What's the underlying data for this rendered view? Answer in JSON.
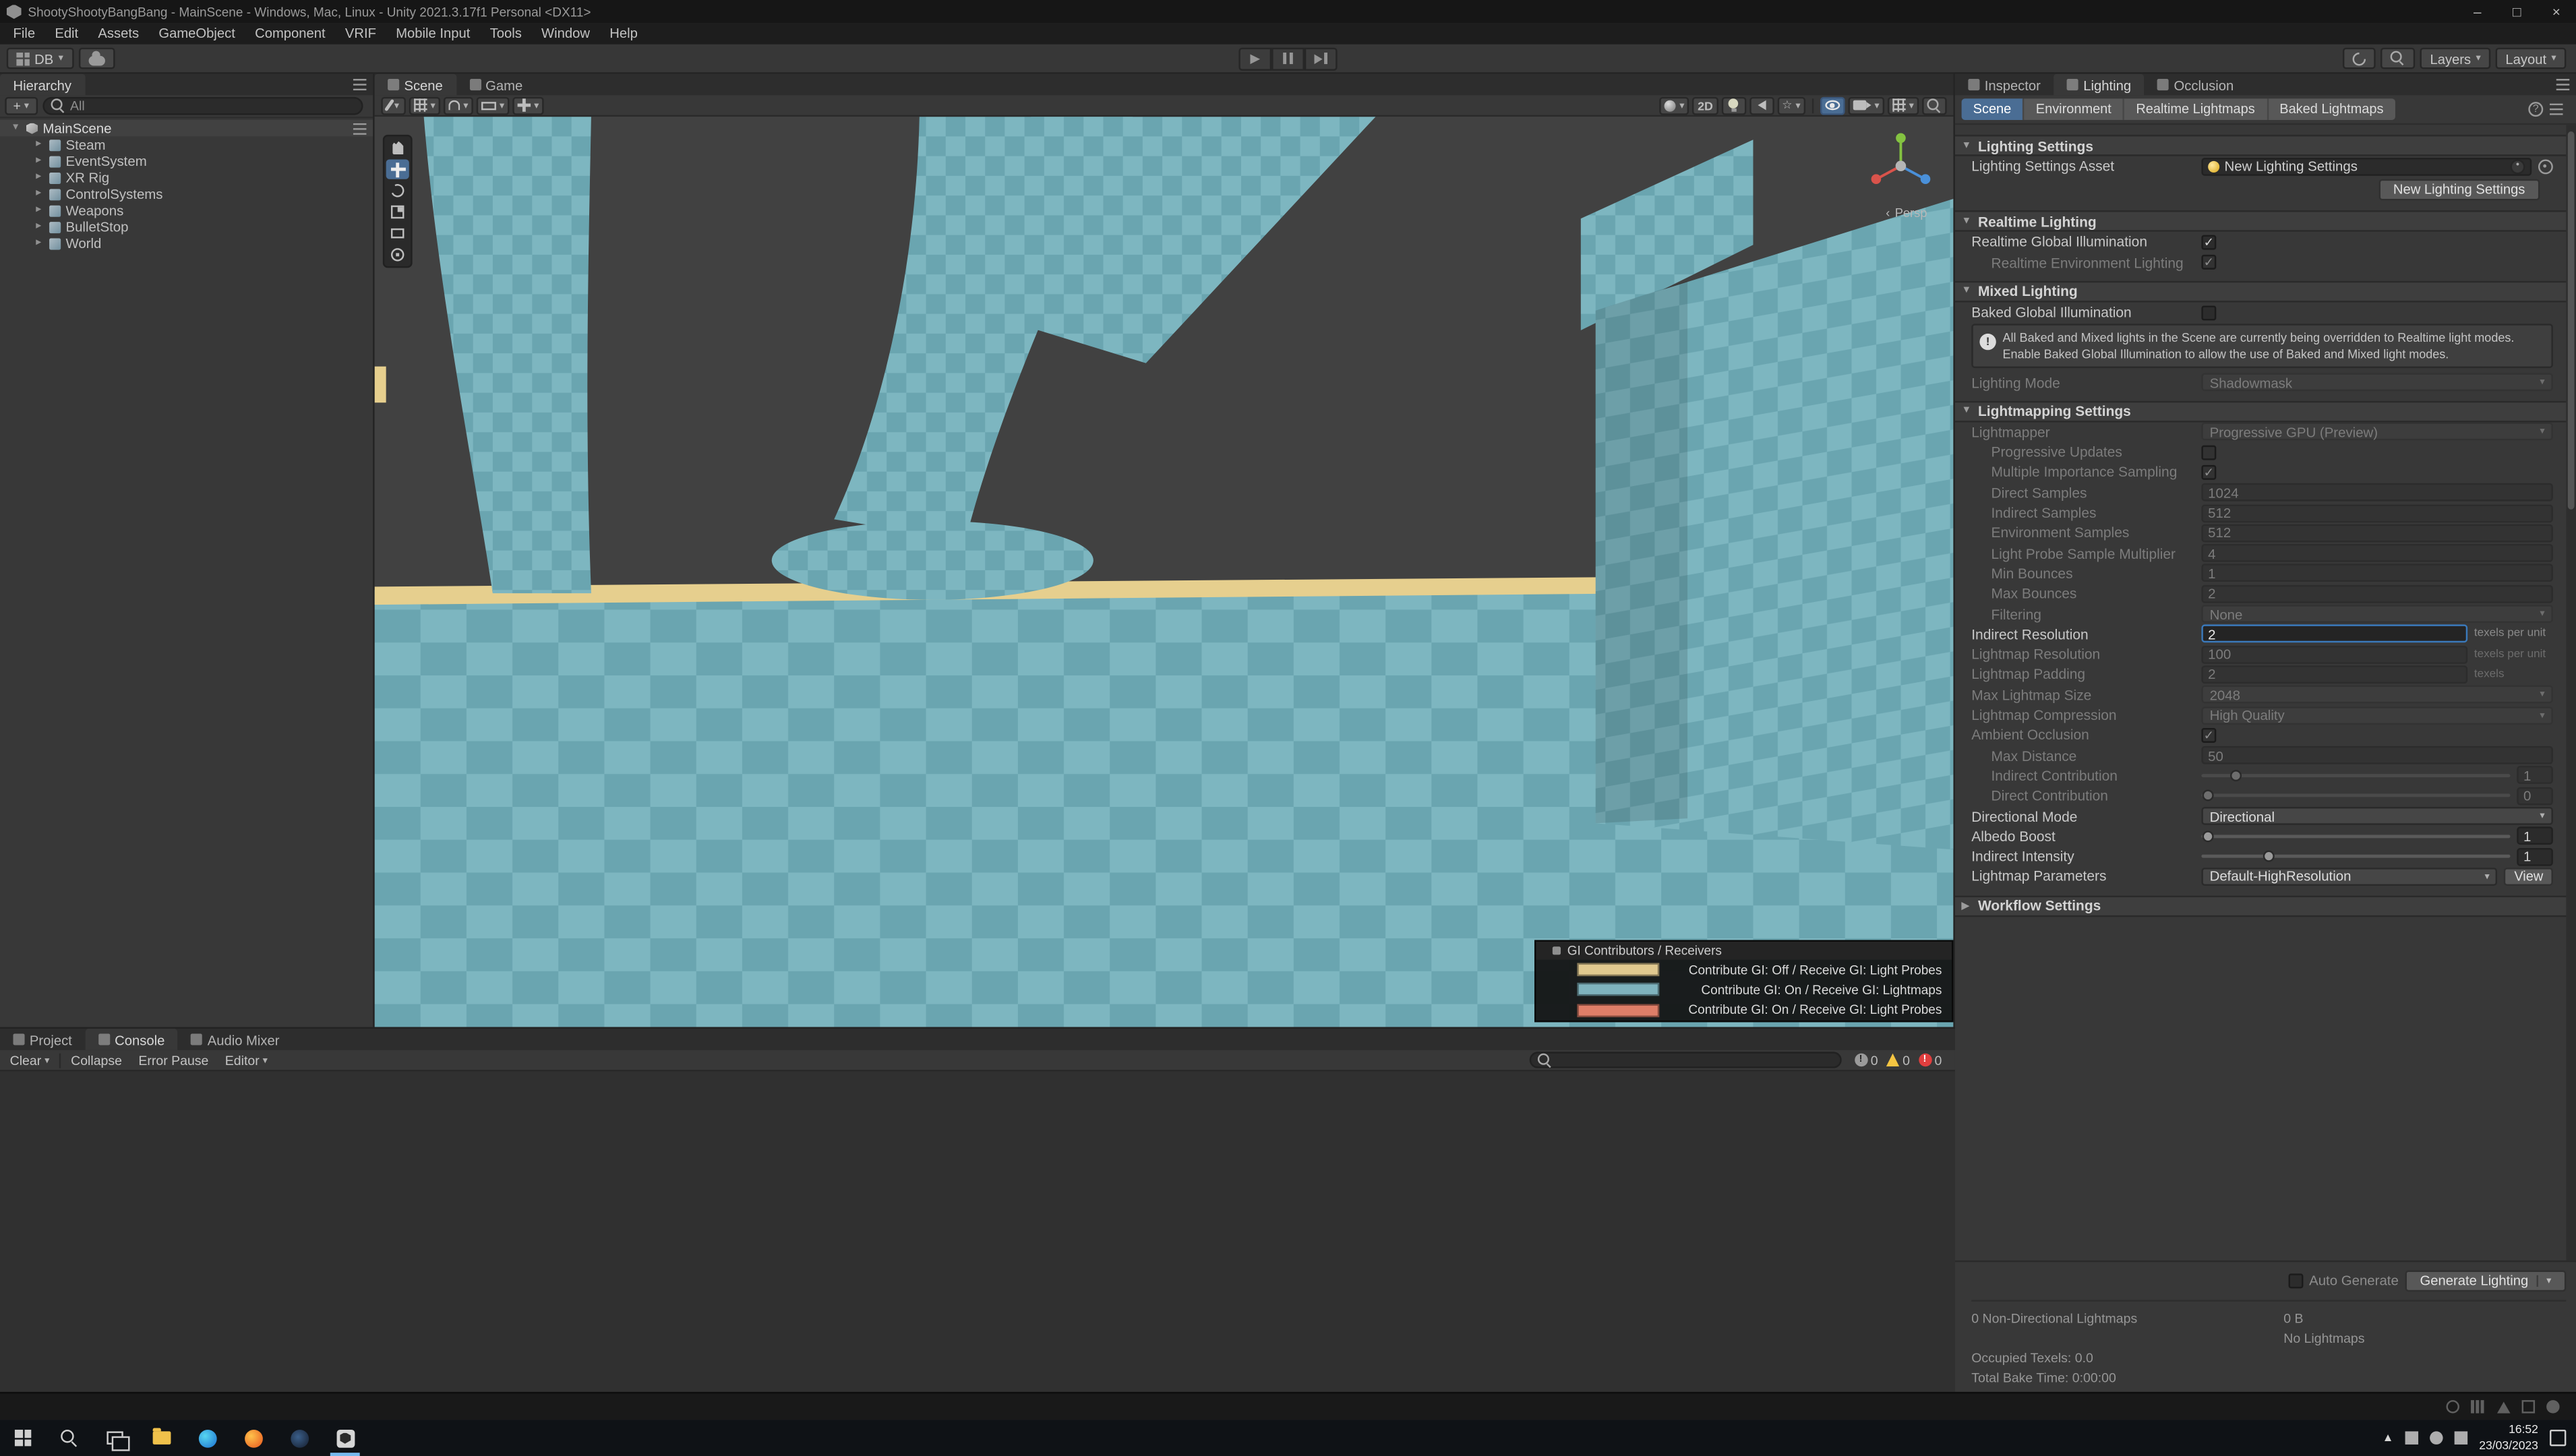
{
  "window": {
    "title": "ShootyShootyBangBang - MainScene - Windows, Mac, Linux - Unity 2021.3.17f1 Personal <DX11>",
    "menu_items": [
      "File",
      "Edit",
      "Assets",
      "GameObject",
      "Component",
      "VRIF",
      "Mobile Input",
      "Tools",
      "Window",
      "Help"
    ]
  },
  "toolbar": {
    "version_control": "DB",
    "layers": "Layers",
    "layout": "Layout"
  },
  "hierarchy": {
    "tab_title": "Hierarchy",
    "search_filter": "All",
    "scene_name": "MainScene",
    "items": [
      "Steam",
      "EventSystem",
      "XR Rig",
      "ControlSystems",
      "Weapons",
      "BulletStop",
      "World"
    ]
  },
  "scene_view": {
    "tabs": [
      "Scene",
      "Game"
    ],
    "active_tab": "Scene",
    "projection_label": "Persp",
    "gi_legend": {
      "title": "GI Contributors / Receivers",
      "rows": [
        {
          "color": "#e0c98f",
          "label": "Contribute GI: Off / Receive GI: Light Probes"
        },
        {
          "color": "#7fb3be",
          "label": "Contribute GI: On / Receive GI: Lightmaps"
        },
        {
          "color": "#de7e68",
          "label": "Contribute GI: On / Receive GI: Light Probes"
        }
      ]
    }
  },
  "inspector": {
    "tabs": [
      "Inspector",
      "Lighting",
      "Occlusion"
    ],
    "active_tab": "Lighting",
    "subtabs": [
      "Scene",
      "Environment",
      "Realtime Lightmaps",
      "Baked Lightmaps"
    ],
    "active_subtab": "Scene",
    "sections": [
      {
        "title": "Lighting Settings",
        "expanded": true,
        "rows": [
          {
            "type": "object",
            "label": "Lighting Settings Asset",
            "value": "New Lighting Settings"
          },
          {
            "type": "button_row",
            "button": "New Lighting Settings"
          }
        ]
      },
      {
        "title": "Realtime Lighting",
        "expanded": true,
        "rows": [
          {
            "type": "checkbox",
            "label": "Realtime Global Illumination",
            "checked": true
          },
          {
            "type": "checkbox",
            "label": "Realtime Environment Lighting",
            "checked": true,
            "disabled": true,
            "indent": 1
          }
        ]
      },
      {
        "title": "Mixed Lighting",
        "expanded": true,
        "rows": [
          {
            "type": "checkbox",
            "label": "Baked Global Illumination",
            "checked": false
          },
          {
            "type": "helpbox",
            "text": "All Baked and Mixed lights in the Scene are currently being overridden to Realtime light modes. Enable Baked Global Illumination to allow the use of Baked and Mixed light modes."
          },
          {
            "type": "dropdown",
            "label": "Lighting Mode",
            "value": "Shadowmask",
            "disabled": true
          }
        ]
      },
      {
        "title": "Lightmapping Settings",
        "expanded": true,
        "rows": [
          {
            "type": "dropdown",
            "label": "Lightmapper",
            "value": "Progressive GPU (Preview)",
            "disabled": true
          },
          {
            "type": "checkbox",
            "label": "Progressive Updates",
            "checked": false,
            "disabled": true,
            "indent": 1
          },
          {
            "type": "checkbox",
            "label": "Multiple Importance Sampling",
            "checked": true,
            "disabled": true,
            "indent": 1
          },
          {
            "type": "field",
            "label": "Direct Samples",
            "value": "1024",
            "disabled": true,
            "indent": 1
          },
          {
            "type": "field",
            "label": "Indirect Samples",
            "value": "512",
            "disabled": true,
            "indent": 1
          },
          {
            "type": "field",
            "label": "Environment Samples",
            "value": "512",
            "disabled": true,
            "indent": 1
          },
          {
            "type": "field",
            "label": "Light Probe Sample Multiplier",
            "value": "4",
            "disabled": true,
            "indent": 1
          },
          {
            "type": "field",
            "label": "Min Bounces",
            "value": "1",
            "disabled": true,
            "indent": 1
          },
          {
            "type": "field",
            "label": "Max Bounces",
            "value": "2",
            "disabled": true,
            "indent": 1
          },
          {
            "type": "dropdown",
            "label": "Filtering",
            "value": "None",
            "disabled": true,
            "indent": 1
          },
          {
            "type": "field",
            "label": "Indirect Resolution",
            "value": "2",
            "unit": "texels per unit",
            "active": true
          },
          {
            "type": "field",
            "label": "Lightmap Resolution",
            "value": "100",
            "unit": "texels per unit",
            "disabled": true
          },
          {
            "type": "field",
            "label": "Lightmap Padding",
            "value": "2",
            "unit": "texels",
            "disabled": true
          },
          {
            "type": "dropdown",
            "label": "Max Lightmap Size",
            "value": "2048",
            "disabled": true
          },
          {
            "type": "dropdown",
            "label": "Lightmap Compression",
            "value": "High Quality",
            "disabled": true
          },
          {
            "type": "checkbox",
            "label": "Ambient Occlusion",
            "checked": true,
            "disabled": true
          },
          {
            "type": "field",
            "label": "Max Distance",
            "value": "50",
            "disabled": true,
            "indent": 1
          },
          {
            "type": "slider",
            "label": "Indirect Contribution",
            "value": "1",
            "pos": 0.11,
            "disabled": true,
            "indent": 1
          },
          {
            "type": "slider",
            "label": "Direct Contribution",
            "value": "0",
            "pos": 0.02,
            "disabled": true,
            "indent": 1
          },
          {
            "type": "dropdown",
            "label": "Directional Mode",
            "value": "Directional"
          },
          {
            "type": "slider",
            "label": "Albedo Boost",
            "value": "1",
            "pos": 0.02
          },
          {
            "type": "slider",
            "label": "Indirect Intensity",
            "value": "1",
            "pos": 0.22
          },
          {
            "type": "dropdown_view",
            "label": "Lightmap Parameters",
            "value": "Default-HighResolution",
            "button": "View"
          }
        ]
      },
      {
        "title": "Workflow Settings",
        "expanded": false,
        "rows": []
      }
    ],
    "footer": {
      "auto_generate": "Auto Generate",
      "generate": "Generate Lighting"
    },
    "stats": {
      "rows": [
        {
          "left": "0 Non-Directional Lightmaps",
          "right": "0 B"
        },
        {
          "left": "",
          "right": "No Lightmaps"
        },
        {
          "left": "Occupied Texels: 0.0",
          "right": ""
        },
        {
          "left": "Total Bake Time: 0:00:00",
          "right": ""
        }
      ]
    }
  },
  "bottom_panel": {
    "tabs": [
      "Project",
      "Console",
      "Audio Mixer"
    ],
    "active_tab": "Console",
    "console": {
      "buttons": [
        {
          "label": "Clear",
          "caret": true
        },
        {
          "label": "Collapse"
        },
        {
          "label": "Error Pause"
        },
        {
          "label": "Editor",
          "caret": true
        }
      ],
      "counts": [
        {
          "kind": "info",
          "value": "0"
        },
        {
          "kind": "warning",
          "value": "0"
        },
        {
          "kind": "error",
          "value": "0"
        }
      ]
    }
  },
  "taskbar": {
    "time": "16:52",
    "date": "23/03/2023"
  },
  "colors": {
    "accent_blue": "#4a6d94",
    "focus_blue": "#3a79bb",
    "checker_light": "#7db6c0",
    "checker_dark": "#6aa5b0",
    "ground_yellow": "#e6cf8e"
  }
}
